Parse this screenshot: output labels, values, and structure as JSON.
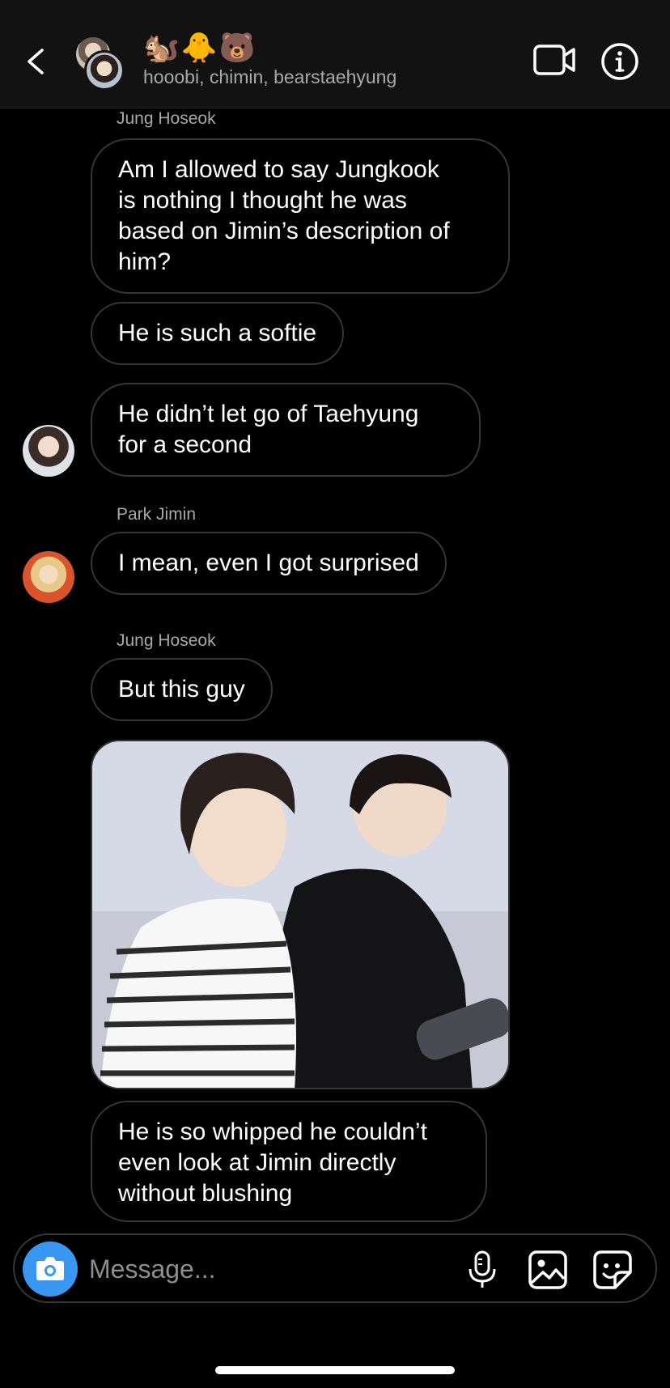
{
  "header": {
    "title": "🐿️🐥🐻",
    "subtitle": "hooobi, chimin, bearstaehyung",
    "icons": {
      "back": "chevron-left-icon",
      "video": "video-camera-icon",
      "info": "info-icon"
    }
  },
  "messages": {
    "sender1": "Jung Hoseok",
    "m1": [
      "Am I allowed to say Jungkook",
      "is nothing I thought he was",
      "based on Jimin’s description of",
      "him?"
    ],
    "m2": "He is such a softie",
    "m3": [
      "He didn’t let go of Taehyung",
      "for a second"
    ],
    "sender2": "Park Jimin",
    "m4": "I mean, even I got surprised",
    "sender3": "Jung Hoseok",
    "m5": "But this guy",
    "m6": [
      "He is so whipped he couldn’t",
      "even look at Jimin directly",
      "without blushing"
    ]
  },
  "composer": {
    "placeholder": "Message...",
    "icons": [
      "camera-icon",
      "microphone-icon",
      "gallery-icon",
      "sticker-icon"
    ]
  },
  "colors": {
    "accent": "#3897f0",
    "bubble_border": "#363636",
    "header_bg": "#121212",
    "muted": "#a8a8a8"
  }
}
